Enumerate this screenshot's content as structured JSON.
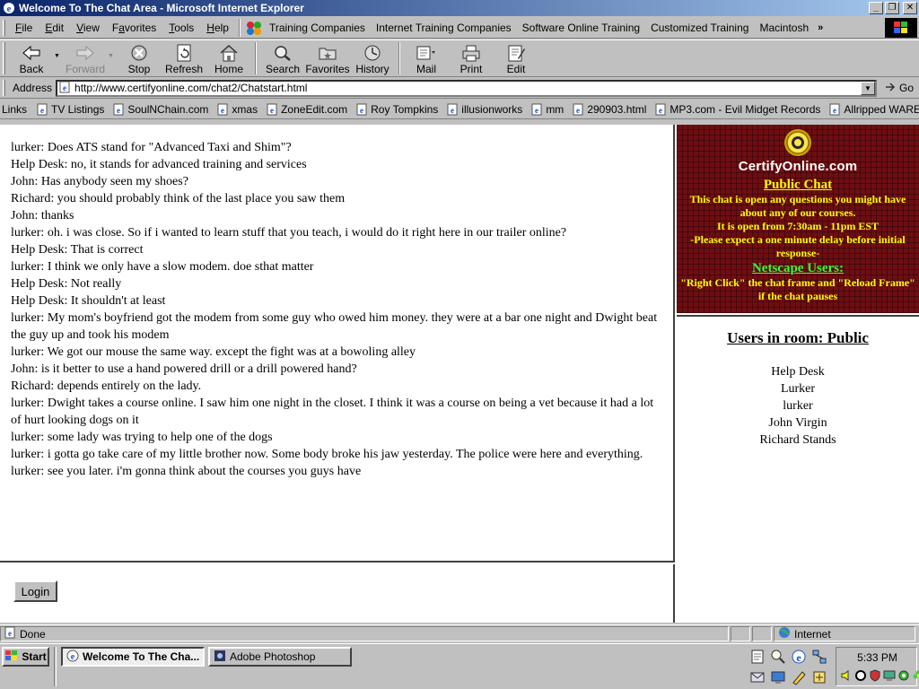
{
  "window": {
    "title": "Welcome To The Chat Area - Microsoft Internet Explorer"
  },
  "menu": {
    "items": [
      {
        "label": "File",
        "key": "F",
        "rest": "ile"
      },
      {
        "label": "Edit",
        "key": "E",
        "rest": "dit"
      },
      {
        "label": "View",
        "key": "V",
        "rest": "iew"
      },
      {
        "label": "Favorites",
        "key": "a",
        "pre": "F",
        "rest": "vorites"
      },
      {
        "label": "Tools",
        "key": "T",
        "rest": "ools"
      },
      {
        "label": "Help",
        "key": "H",
        "rest": "elp"
      }
    ]
  },
  "top_links": [
    "Training Companies",
    "Internet Training Companies",
    "Software Online Training",
    "Customized Training",
    "Macintosh"
  ],
  "toolbar": {
    "back": "Back",
    "forward": "Forward",
    "stop": "Stop",
    "refresh": "Refresh",
    "home": "Home",
    "search": "Search",
    "favorites": "Favorites",
    "history": "History",
    "mail": "Mail",
    "print": "Print",
    "edit": "Edit"
  },
  "address": {
    "label": "Address",
    "url": "http://www.certifyonline.com/chat2/Chatstart.html",
    "go": "Go"
  },
  "links": {
    "label": "Links",
    "items": [
      "TV Listings",
      "SoulNChain.com",
      "xmas",
      "ZoneEdit.com",
      "Roy Tompkins",
      "illusionworks",
      "mm",
      "290903.html",
      "MP3.com - Evil Midget Records",
      "Allripped WAREZ"
    ]
  },
  "chat": {
    "messages": [
      "lurker: Does ATS stand for \"Advanced Taxi and Shim\"?",
      "Help Desk: no, it stands for advanced training and services",
      "John: Has anybody seen my shoes?",
      "Richard: you should probably think of the last place you saw them",
      "John: thanks",
      "lurker: oh. i was close. So if i wanted to learn stuff that you teach, i would do it right here in our trailer online?",
      "Help Desk: That is correct",
      "lurker: I think we only have a slow modem. doe sthat matter",
      "Help Desk: Not really",
      "Help Desk: It shouldn't at least",
      "lurker: My mom's boyfriend got the modem from some guy who owed him money. they were at a bar one night and Dwight beat the guy up and took his modem",
      "lurker: We got our mouse the same way. except the fight was at a bowoling alley",
      "John: is it better to use a hand powered drill or a drill powered hand?",
      "Richard: depends entirely on the lady.",
      "lurker: Dwight takes a course online. I saw him one night in the closet. I think it was a course on being a vet because it had a lot of hurt looking dogs on it",
      "lurker: some lady was trying to help one of the dogs",
      "lurker: i gotta go take care of my little brother now. Some body broke his jaw yesterday. The police were here and everything.",
      "lurker: see you later. i'm gonna think about the courses you guys have"
    ],
    "login_label": "Login"
  },
  "banner": {
    "brand": "CertifyOnline.com",
    "public_chat": "Public Chat",
    "line1": "This chat is open  any questions you might have about any of our courses.",
    "line2": "It is open from 7:30am - 11pm EST",
    "line3": "-Please expect a one minute delay before initial response-",
    "netscape": "Netscape Users:",
    "line4": "\"Right Click\" the chat frame and \"Reload Frame\" if the chat pauses"
  },
  "users": {
    "heading": "Users in room: Public",
    "list": [
      "Help Desk",
      "Lurker",
      "lurker",
      "John Virgin",
      "Richard Stands"
    ]
  },
  "status": {
    "text": "Done",
    "zone": "Internet"
  },
  "taskbar": {
    "start": "Start",
    "tasks": [
      "Welcome To The Cha...",
      "Adobe Photoshop"
    ],
    "clock": "5:33 PM"
  },
  "colors": {
    "titlebar_start": "#0a246a",
    "banner_bg": "#6e0e12",
    "banner_text": "#ffff00",
    "netscape_text": "#33ff33"
  }
}
